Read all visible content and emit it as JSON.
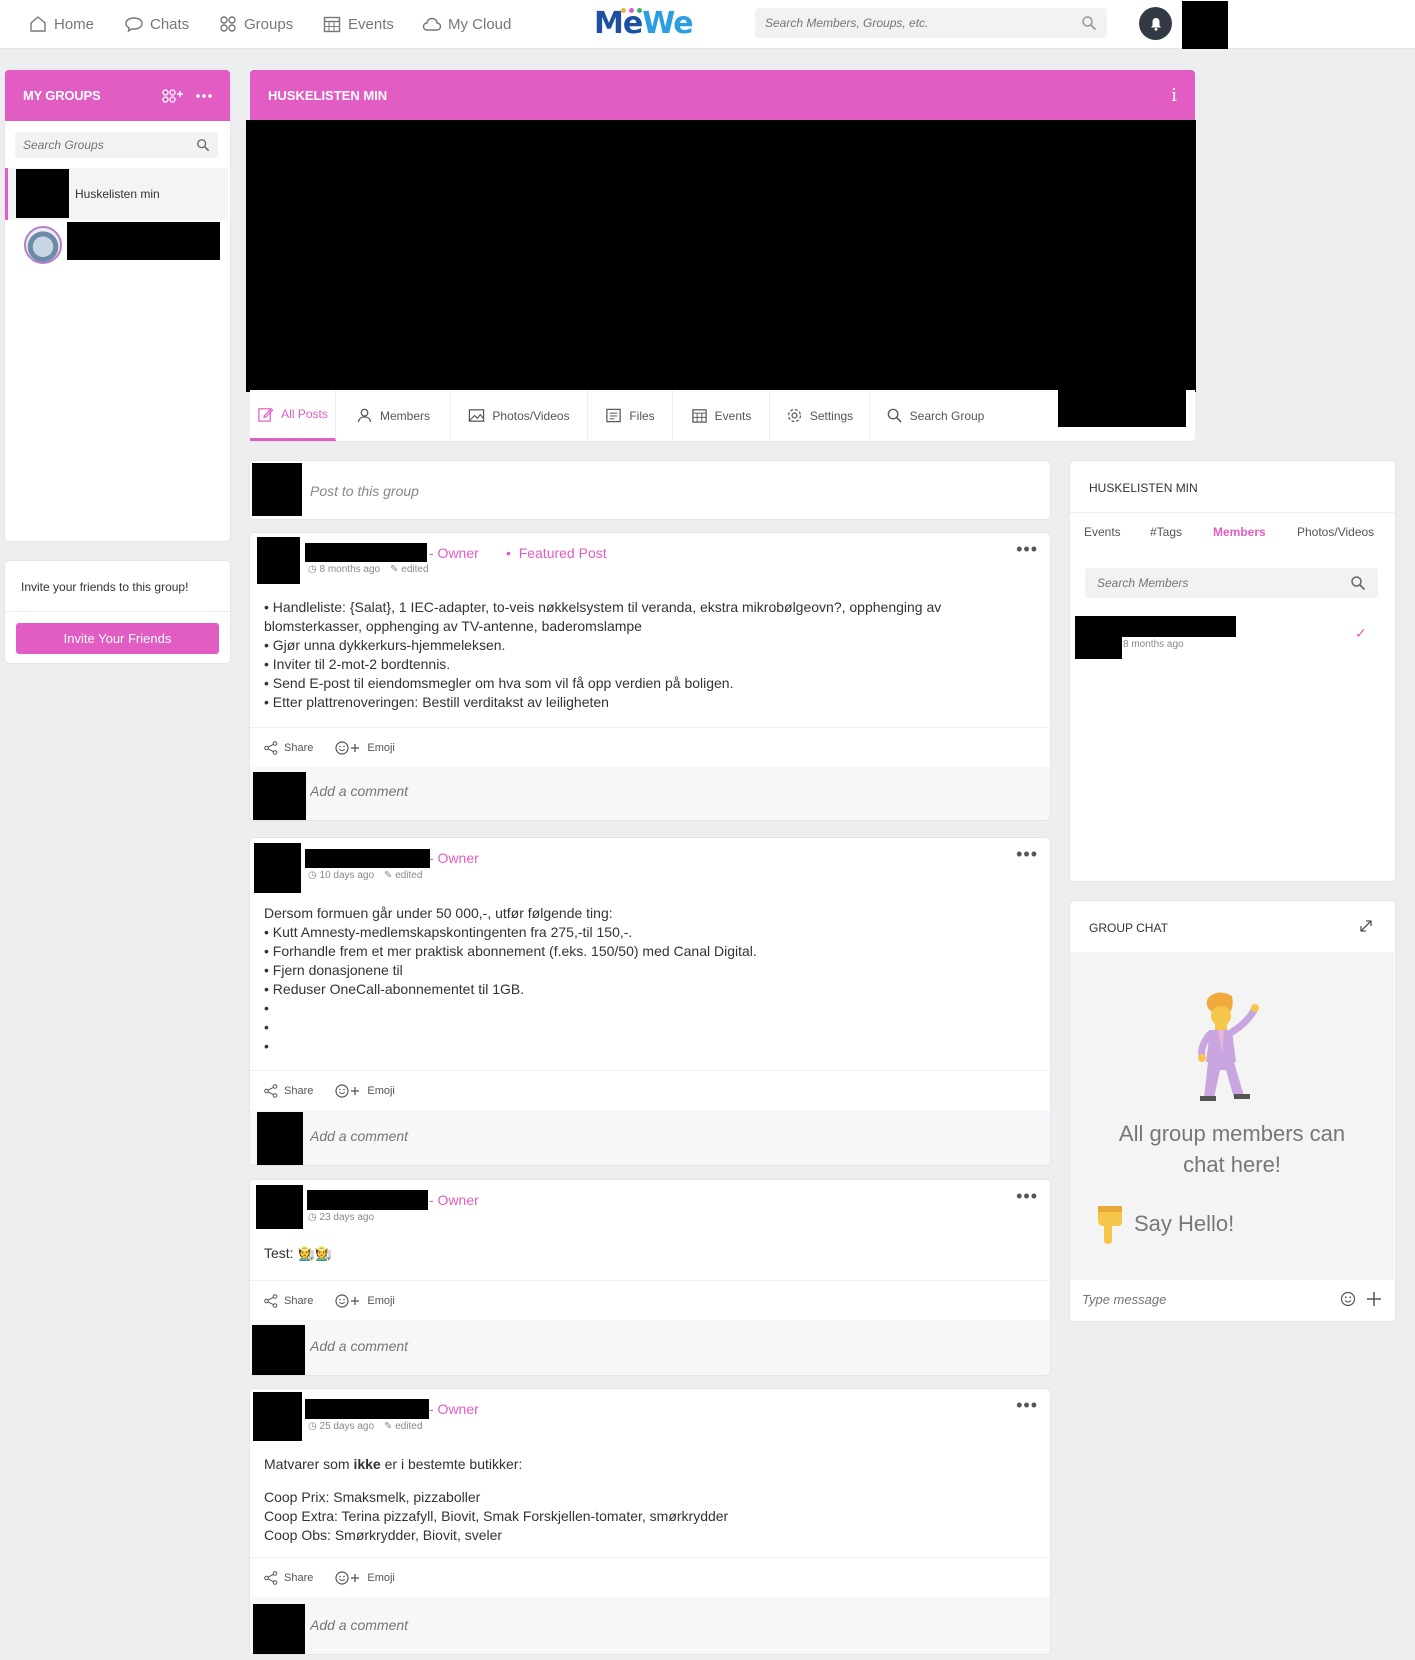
{
  "nav": {
    "home": "Home",
    "chats": "Chats",
    "groups": "Groups",
    "events": "Events",
    "my_cloud": "My Cloud",
    "logo": "MeWe",
    "search_placeholder": "Search Members, Groups, etc."
  },
  "sidebar": {
    "title": "MY GROUPS",
    "search_placeholder": "Search Groups",
    "groups": [
      {
        "label": "Huskelisten min"
      }
    ],
    "invite_text": "Invite your friends to this group!",
    "invite_button": "Invite Your Friends"
  },
  "group": {
    "title": "HUSKELISTEN MIN",
    "tabs": [
      {
        "label": "All Posts",
        "icon": "edit-icon"
      },
      {
        "label": "Members",
        "icon": "person-icon"
      },
      {
        "label": "Photos/Videos",
        "icon": "image-icon"
      },
      {
        "label": "Files",
        "icon": "file-icon"
      },
      {
        "label": "Events",
        "icon": "calendar-icon"
      },
      {
        "label": "Settings",
        "icon": "gear-icon"
      },
      {
        "label": "Search Group",
        "icon": "search-icon"
      }
    ],
    "composer_placeholder": "Post to this group"
  },
  "posts": [
    {
      "role": "- Owner",
      "featured": "Featured Post",
      "time": "8 months ago",
      "edited": "edited",
      "lines": [
        "• Handleliste: {Salat}, 1 IEC-adapter, to-veis nøkkelsystem til veranda, ekstra mikrobølgeovn?, opphenging av",
        "blomsterkasser, opphenging av TV-antenne, baderomslampe",
        "• Gjør unna dykkerkurs-hjemmeleksen.",
        "• Inviter til 2-mot-2 bordtennis.",
        "• Send E-post til eiendomsmegler om hva som vil få opp verdien på boligen.",
        "• Etter plattrenoveringen: Bestill verditakst av leiligheten"
      ],
      "share": "Share",
      "emoji": "Emoji",
      "comment_placeholder": "Add a comment"
    },
    {
      "role": "- Owner",
      "time": "10 days ago",
      "edited": "edited",
      "lines": [
        "Dersom formuen går under 50 000,-, utfør følgende ting:",
        "• Kutt Amnesty-medlemskapskontingenten fra 275,-til 150,-.",
        "• Forhandle frem et mer praktisk abonnement (f.eks. 150/50) med Canal Digital.",
        "• Fjern donasjonene til",
        "• Reduser OneCall-abonnementet til 1GB.",
        "•",
        "•",
        "•"
      ],
      "share": "Share",
      "emoji": "Emoji",
      "comment_placeholder": "Add a comment"
    },
    {
      "role": "- Owner",
      "time": "23 days ago",
      "lines": [
        "Test: 🧑‍🌾🧑‍🌾"
      ],
      "share": "Share",
      "emoji": "Emoji",
      "comment_placeholder": "Add a comment"
    },
    {
      "role": "- Owner",
      "time": "25 days ago",
      "edited": "edited",
      "intro_pre": "Matvarer som ",
      "intro_bold": "ikke",
      "intro_post": " er i bestemte butikker:",
      "lines": [
        "Coop Prix: Smaksmelk, pizzaboller",
        "Coop Extra: Terina pizzafyll, Biovit, Smak Forskjellen-tomater, smørkrydder",
        "Coop Obs: Smørkrydder, Biovit, sveler"
      ],
      "share": "Share",
      "emoji": "Emoji",
      "comment_placeholder": "Add a comment"
    }
  ],
  "right_panel": {
    "title": "HUSKELISTEN MIN",
    "tabs": [
      "Events",
      "#Tags",
      "Members",
      "Photos/Videos"
    ],
    "active_tab": "Members",
    "search_placeholder": "Search Members",
    "member_time": "8 months ago"
  },
  "chat": {
    "title": "GROUP CHAT",
    "line1": "All group members can",
    "line2": "chat here!",
    "say_hello": "Say Hello!",
    "placeholder": "Type message"
  },
  "colors": {
    "accent": "#e15dc3",
    "bell": "#323a45"
  }
}
